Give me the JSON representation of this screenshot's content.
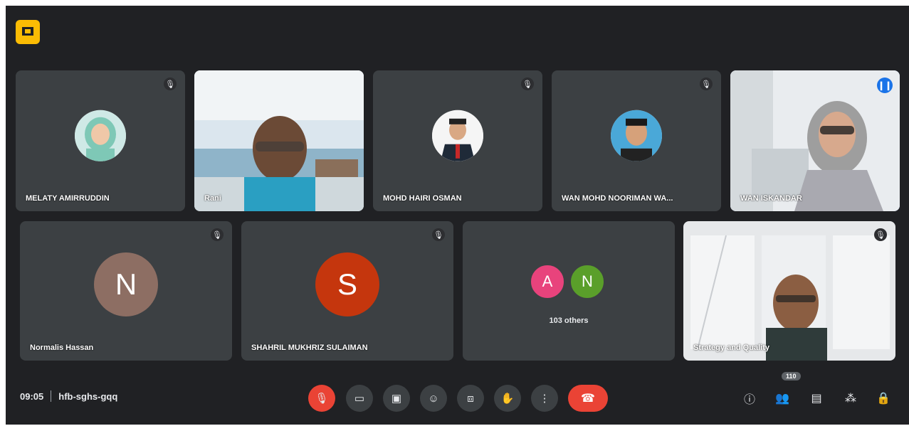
{
  "app": {
    "badge_icon": "presentation-icon",
    "accent": "#fbbc04"
  },
  "tiles": [
    {
      "name": "MELATY AMIRRUDDIN",
      "kind": "photo-avatar",
      "muted": true
    },
    {
      "name": "Rani",
      "kind": "video",
      "muted": false
    },
    {
      "name": "MOHD HAIRI OSMAN",
      "kind": "photo-avatar",
      "muted": true
    },
    {
      "name": "WAN MOHD NOORIMAN WA...",
      "kind": "photo-avatar",
      "muted": true
    },
    {
      "name": "WAN ISKANDAR",
      "kind": "video",
      "speaking": true
    },
    {
      "name": "Normalis Hassan",
      "kind": "letter-avatar",
      "letter": "N",
      "color": "#8d6e63",
      "muted": true
    },
    {
      "name": "SHAHRIL MUKHRIZ SULAIMAN",
      "kind": "letter-avatar",
      "letter": "S",
      "color": "#c5360d",
      "muted": true
    },
    {
      "name": "103 others",
      "kind": "others",
      "letters": [
        "A",
        "N"
      ],
      "colors": [
        "#e8437c",
        "#5a9f2a"
      ]
    },
    {
      "name": "Strategy and Quality",
      "kind": "video",
      "muted": true
    }
  ],
  "meeting": {
    "time": "09:05",
    "code": "hfb-sghs-gqq"
  },
  "controls": [
    {
      "icon": "mic-off-icon",
      "glyph": "🎙"
    },
    {
      "icon": "camera-icon",
      "glyph": "▭"
    },
    {
      "icon": "captions-icon",
      "glyph": "▣"
    },
    {
      "icon": "emoji-icon",
      "glyph": "☺"
    },
    {
      "icon": "present-icon",
      "glyph": "⧈"
    },
    {
      "icon": "raise-hand-icon",
      "glyph": "✋"
    },
    {
      "icon": "more-options-icon",
      "glyph": "⋮"
    },
    {
      "icon": "hang-up-icon",
      "glyph": "☎"
    }
  ],
  "right_controls": [
    {
      "icon": "info-icon",
      "glyph": "ⓘ"
    },
    {
      "icon": "people-icon",
      "glyph": "👥",
      "count": "110"
    },
    {
      "icon": "chat-icon",
      "glyph": "▤"
    },
    {
      "icon": "activities-icon",
      "glyph": "⁂"
    },
    {
      "icon": "lock-icon",
      "glyph": "🔒"
    }
  ]
}
